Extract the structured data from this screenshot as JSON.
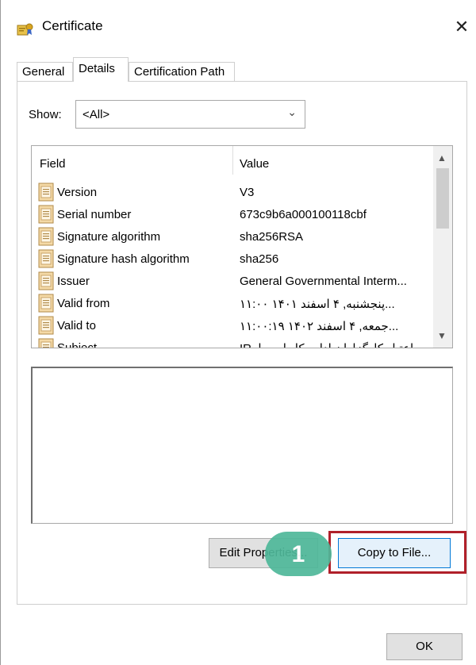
{
  "window": {
    "title": "Certificate",
    "close_glyph": "✕"
  },
  "tabs": [
    {
      "label": "General",
      "active": false
    },
    {
      "label": "Details",
      "active": true
    },
    {
      "label": "Certification Path",
      "active": false
    }
  ],
  "show": {
    "label": "Show:",
    "selected": "<All>"
  },
  "table": {
    "columns": [
      "Field",
      "Value"
    ],
    "rows": [
      {
        "field": "Version",
        "value": "V3"
      },
      {
        "field": "Serial number",
        "value": "673c9b6a000100118cbf"
      },
      {
        "field": "Signature algorithm",
        "value": "sha256RSA"
      },
      {
        "field": "Signature hash algorithm",
        "value": "sha256"
      },
      {
        "field": "Issuer",
        "value": "General Governmental Interm..."
      },
      {
        "field": "Valid from",
        "value": "...پنجشنبه, ۴ اسفند ۱۴۰۱ ۱۱:۰۰"
      },
      {
        "field": "Valid to",
        "value": "...جمعه, ۴ اسفند ۱۴۰۲ ۱۱:۰۰:۱۹"
      },
      {
        "field": "Subject",
        "value": "IR, اعتبار کارگزاران اداره کل امور ا..."
      }
    ]
  },
  "buttons": {
    "edit_properties": "Edit Properties...",
    "copy_to_file": "Copy to File...",
    "ok": "OK"
  },
  "annotation": {
    "step": "1"
  },
  "colors": {
    "highlight": "#b0202a",
    "badge": "#4fb89a"
  }
}
